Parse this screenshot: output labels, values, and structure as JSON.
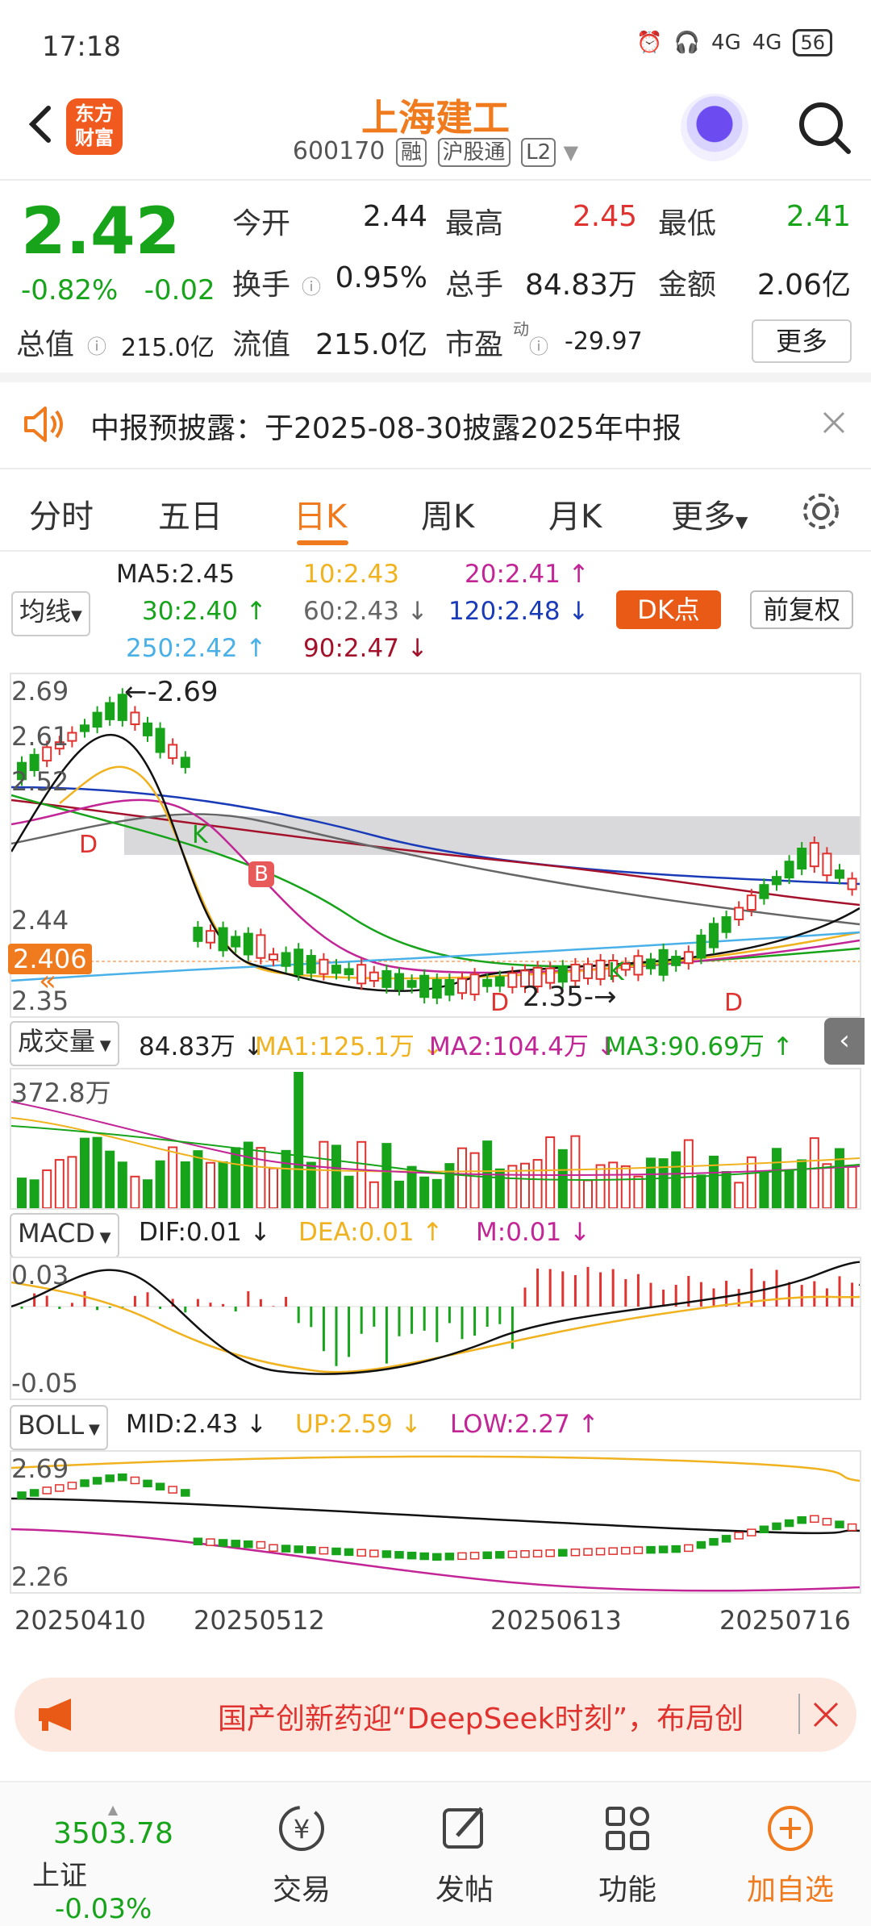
{
  "status": {
    "time": "17:18",
    "net1": "4G",
    "net2": "4G",
    "battery": "56"
  },
  "header": {
    "title": "上海建工",
    "code": "600170",
    "tags": [
      "融",
      "沪股通",
      "L2"
    ],
    "logo": "东方\n财富"
  },
  "quote": {
    "price": "2.42",
    "change_pct": "-0.82%",
    "change": "-0.02",
    "fields": [
      {
        "label": "今开",
        "value": "2.44",
        "color": "#222"
      },
      {
        "label": "最高",
        "value": "2.45",
        "color": "#e0322e"
      },
      {
        "label": "最低",
        "value": "2.41",
        "color": "#17a31a"
      },
      {
        "label": "换手",
        "value": "0.95%",
        "color": "#222"
      },
      {
        "label": "总手",
        "value": "84.83万",
        "color": "#222"
      },
      {
        "label": "金额",
        "value": "2.06亿",
        "color": "#222"
      },
      {
        "label": "总值",
        "value": "215.0亿",
        "color": "#222"
      },
      {
        "label": "流值",
        "value": "215.0亿",
        "color": "#222"
      },
      {
        "label": "市盈",
        "value": "-29.97",
        "color": "#222"
      }
    ],
    "pe_sup": "动",
    "more_label": "更多"
  },
  "notice": {
    "text": "中报预披露：于2025-08-30披露2025年中报"
  },
  "tabs": [
    "分时",
    "五日",
    "日K",
    "周K",
    "月K",
    "更多"
  ],
  "active_tab": "日K",
  "ma": {
    "select": "均线",
    "ma5": "MA5:2.45",
    "ma10": "10:2.43",
    "ma20": "20:2.41 ↑",
    "ma30": "30:2.40 ↑",
    "ma60": "60:2.43 ↓",
    "ma120": "120:2.48 ↓",
    "ma250": "250:2.42 ↑",
    "ma90": "90:2.47 ↓",
    "dk_label": "DK点",
    "fq_label": "前复权"
  },
  "kline": {
    "y_labels": [
      "2.69",
      "2.61",
      "2.52",
      "2.44",
      "2.35"
    ],
    "high_mark": "2.69",
    "low_mark": "2.35",
    "current": "2.406",
    "markers": [
      "K",
      "D",
      "B",
      "D",
      "K",
      "D"
    ]
  },
  "volume": {
    "select": "成交量",
    "vol": "84.83万 ↓",
    "ma1": "MA1:125.1万 ↓",
    "ma2": "MA2:104.4万 ↓",
    "ma3": "MA3:90.69万 ↑",
    "max": "372.8万"
  },
  "macd": {
    "select": "MACD",
    "dif": "DIF:0.01 ↓",
    "dea": "DEA:0.01 ↑",
    "m": "M:0.01 ↓",
    "top": "0.03",
    "bottom": "-0.05"
  },
  "boll": {
    "select": "BOLL",
    "mid": "MID:2.43 ↓",
    "up": "UP:2.59 ↓",
    "low": "LOW:2.27 ↑",
    "top": "2.69",
    "bottom": "2.26"
  },
  "dates": [
    "20250410",
    "20250512",
    "20250613",
    "20250716"
  ],
  "ad": {
    "text": "国产创新药迎“DeepSeek时刻”，布局创"
  },
  "nav": {
    "index_value": "3503.78",
    "index_name": "上证",
    "index_change": "-0.03%",
    "items": [
      "交易",
      "发帖",
      "功能",
      "加自选"
    ]
  },
  "colors": {
    "accent": "#f07b1f",
    "up": "#e0322e",
    "down": "#17a31a",
    "brand": "#f05a1e"
  }
}
